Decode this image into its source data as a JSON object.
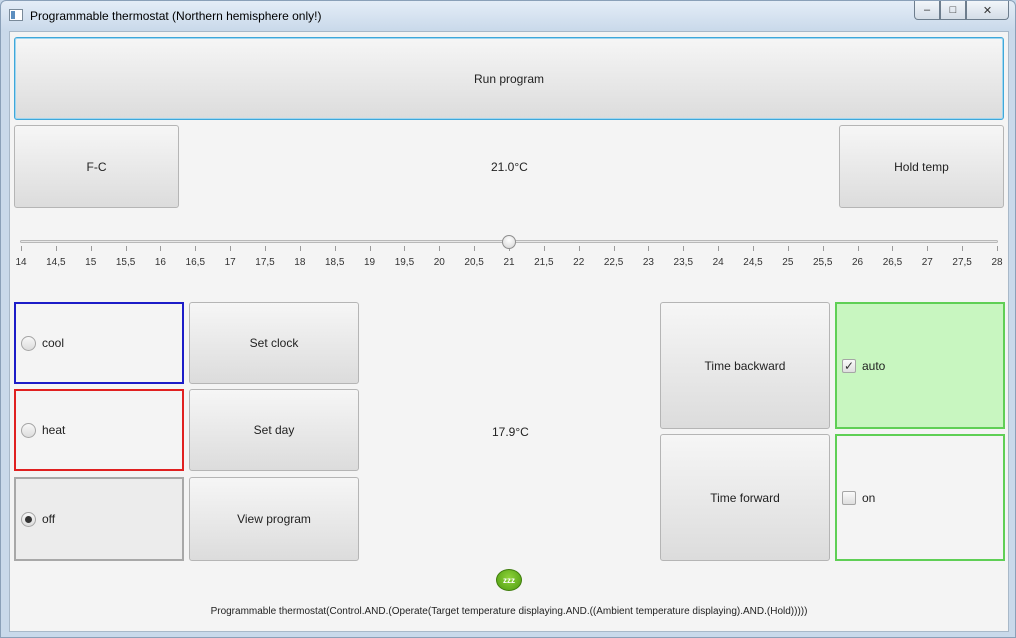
{
  "window": {
    "title": "Programmable thermostat (Northern hemisphere only!)",
    "controls": [
      "–",
      "□",
      "✕"
    ]
  },
  "toolbar": {
    "run_program": "Run program",
    "fc_toggle": "F-C",
    "hold_temp": "Hold temp"
  },
  "target_temperature": "21.0°C",
  "ambient_temperature": "17.9°C",
  "slider": {
    "min": 14,
    "max": 28,
    "value": 21,
    "tick_labels": [
      "14",
      "14,5",
      "15",
      "15,5",
      "16",
      "16,5",
      "17",
      "17,5",
      "18",
      "18,5",
      "19",
      "19,5",
      "20",
      "20,5",
      "21",
      "21,5",
      "22",
      "22,5",
      "23",
      "23,5",
      "24",
      "24,5",
      "25",
      "25,5",
      "26",
      "26,5",
      "27",
      "27,5",
      "28"
    ]
  },
  "modes": {
    "cool": {
      "label": "cool",
      "selected": false,
      "border": "#1c1cc8"
    },
    "heat": {
      "label": "heat",
      "selected": false,
      "border": "#e02020"
    },
    "off": {
      "label": "off",
      "selected": true,
      "border": "#a8a8a8"
    }
  },
  "actions": {
    "set_clock": "Set clock",
    "set_day": "Set day",
    "view_program": "View program",
    "time_backward": "Time backward",
    "time_forward": "Time forward"
  },
  "fan": {
    "auto": {
      "label": "auto",
      "checked": true,
      "bg": "#c8f6c0",
      "border": "#5fcf55"
    },
    "on": {
      "label": "on",
      "checked": false,
      "bg": "#f4f4f4",
      "border": "#5fcf55"
    }
  },
  "sleep_icon": {
    "text": "zzz",
    "color": "#6cbf22"
  },
  "status": "Programmable thermostat(Control.AND.(Operate(Target temperature displaying.AND.((Ambient temperature displaying).AND.(Hold)))))"
}
